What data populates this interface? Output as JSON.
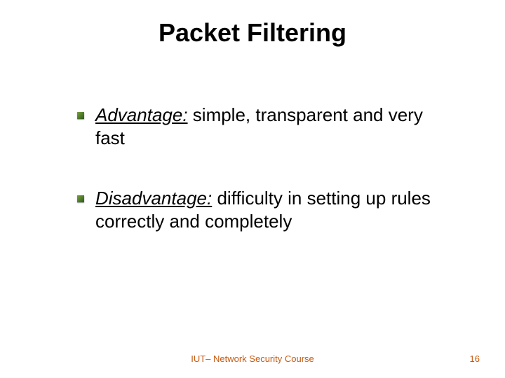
{
  "title": "Packet Filtering",
  "bullets": [
    {
      "lead": "Advantage:",
      "rest": " simple, transparent and very fast"
    },
    {
      "lead": "Disadvantage:",
      "rest": " difficulty in setting up rules correctly  and completely"
    }
  ],
  "footer": {
    "center": "IUT– Network Security Course",
    "page": "16"
  }
}
